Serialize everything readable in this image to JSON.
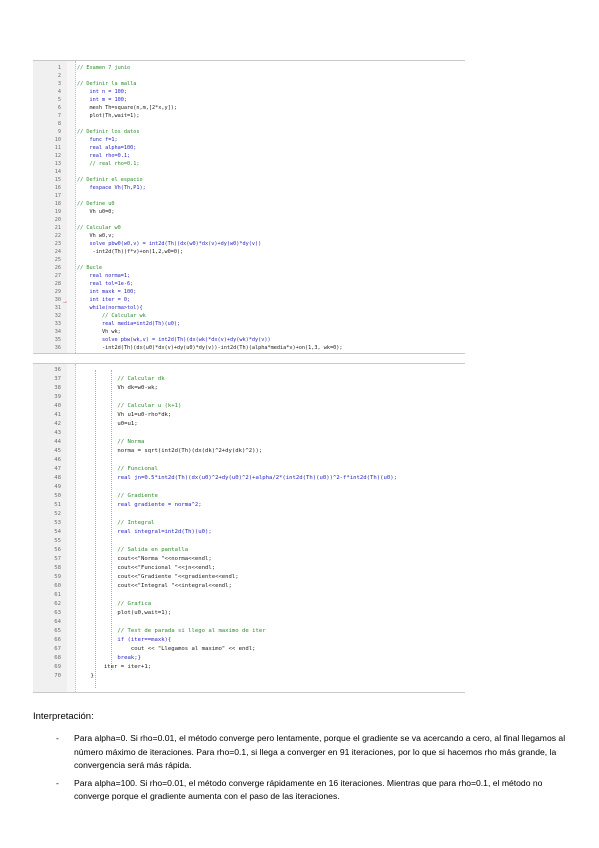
{
  "editor_top": {
    "lines": [
      {
        "n": "1",
        "text": "// Examen 7 junio",
        "kind": "comment"
      },
      {
        "n": "2",
        "text": "",
        "kind": "plain"
      },
      {
        "n": "3",
        "text": "// Definir la malla",
        "kind": "comment"
      },
      {
        "n": "4",
        "text": "    int n = 100;",
        "kind": "keyword"
      },
      {
        "n": "5",
        "text": "    int m = 100;",
        "kind": "keyword"
      },
      {
        "n": "6",
        "text": "    mesh Th=square(n,m,[2*x,y]);",
        "kind": "plain"
      },
      {
        "n": "7",
        "text": "    plot(Th,wait=1);",
        "kind": "plain"
      },
      {
        "n": "8",
        "text": "",
        "kind": "plain"
      },
      {
        "n": "9",
        "text": "// Definir los datos",
        "kind": "comment"
      },
      {
        "n": "10",
        "text": "    func f=1;",
        "kind": "keyword"
      },
      {
        "n": "11",
        "text": "    real alpha=100;",
        "kind": "keyword"
      },
      {
        "n": "12",
        "text": "    real rho=0.1;",
        "kind": "keyword"
      },
      {
        "n": "13",
        "text": "    // real rho=0.1;",
        "kind": "comment"
      },
      {
        "n": "14",
        "text": "",
        "kind": "plain"
      },
      {
        "n": "15",
        "text": "// Definir el espacio",
        "kind": "comment"
      },
      {
        "n": "16",
        "text": "    fespace Vh(Th,P1);",
        "kind": "keyword"
      },
      {
        "n": "17",
        "text": "",
        "kind": "plain"
      },
      {
        "n": "18",
        "text": "// Define u0",
        "kind": "comment"
      },
      {
        "n": "19",
        "text": "    Vh u0=0;",
        "kind": "plain"
      },
      {
        "n": "20",
        "text": "",
        "kind": "plain"
      },
      {
        "n": "21",
        "text": "// Calcular w0",
        "kind": "comment"
      },
      {
        "n": "22",
        "text": "    Vh w0,v;",
        "kind": "plain"
      },
      {
        "n": "23",
        "text": "    solve pbw0(w0,v) = int2d(Th)(dx(w0)*dx(v)+dy(w0)*dy(v))",
        "kind": "keyword"
      },
      {
        "n": "24",
        "text": "     -int2d(Th)(f*v)+on(1,2,w0=0);",
        "kind": "plain"
      },
      {
        "n": "25",
        "text": "",
        "kind": "plain"
      },
      {
        "n": "26",
        "text": "// Bucle",
        "kind": "comment"
      },
      {
        "n": "27",
        "text": "    real norma=1;",
        "kind": "keyword"
      },
      {
        "n": "28",
        "text": "    real tol=1e-6;",
        "kind": "keyword"
      },
      {
        "n": "29",
        "text": "    int maxk = 100;",
        "kind": "keyword"
      },
      {
        "n": "30",
        "text": "    int iter = 0;",
        "kind": "keyword"
      },
      {
        "n": "31",
        "text": "    while(norma>tol){",
        "kind": "keyword"
      },
      {
        "n": "32",
        "text": "        // Calcular wk",
        "kind": "comment"
      },
      {
        "n": "33",
        "text": "        real media=int2d(Th)(u0);",
        "kind": "keyword"
      },
      {
        "n": "34",
        "text": "        Vh wk;",
        "kind": "plain"
      },
      {
        "n": "35",
        "text": "        solve pbw(wk,v) = int2d(Th)(dx(wk)*dx(v)+dy(wk)*dy(v))",
        "kind": "keyword"
      },
      {
        "n": "36",
        "text": "        -int2d(Th)(dx(u0)*dx(v)+dy(u0)*dy(v))-int2d(Th)(alpha*media*v)+on(1,3, wk=0);",
        "kind": "plain"
      }
    ]
  },
  "editor_bottom": {
    "lines": [
      {
        "n": "36",
        "text": "",
        "kind": "plain"
      },
      {
        "n": "37",
        "text": "            // Calcular dk",
        "kind": "comment"
      },
      {
        "n": "38",
        "text": "            Vh dk=w0-wk;",
        "kind": "plain"
      },
      {
        "n": "39",
        "text": "",
        "kind": "plain"
      },
      {
        "n": "40",
        "text": "            // Calcular u (k+1)",
        "kind": "comment"
      },
      {
        "n": "41",
        "text": "            Vh u1=u0-rho*dk;",
        "kind": "plain"
      },
      {
        "n": "42",
        "text": "            u0=u1;",
        "kind": "plain"
      },
      {
        "n": "43",
        "text": "",
        "kind": "plain"
      },
      {
        "n": "44",
        "text": "            // Norma",
        "kind": "comment"
      },
      {
        "n": "45",
        "text": "            norma = sqrt(int2d(Th)(dx(dk)^2+dy(dk)^2));",
        "kind": "plain"
      },
      {
        "n": "46",
        "text": "",
        "kind": "plain"
      },
      {
        "n": "47",
        "text": "            // Funcional",
        "kind": "comment"
      },
      {
        "n": "48",
        "text": "            real jn=0.5*int2d(Th)(dx(u0)^2+dy(u0)^2)+alpha/2*(int2d(Th)(u0))^2-f*int2d(Th)(u0);",
        "kind": "keyword"
      },
      {
        "n": "49",
        "text": "",
        "kind": "plain"
      },
      {
        "n": "50",
        "text": "            // Gradiente",
        "kind": "comment"
      },
      {
        "n": "51",
        "text": "            real gradiente = norma^2;",
        "kind": "keyword"
      },
      {
        "n": "52",
        "text": "",
        "kind": "plain"
      },
      {
        "n": "53",
        "text": "            // Integral",
        "kind": "comment"
      },
      {
        "n": "54",
        "text": "            real integral=int2d(Th)(u0);",
        "kind": "keyword"
      },
      {
        "n": "55",
        "text": "",
        "kind": "plain"
      },
      {
        "n": "56",
        "text": "            // Salida en pantalla",
        "kind": "comment"
      },
      {
        "n": "57",
        "text": "            cout<<\"Norma \"<<norma<<endl;",
        "kind": "plain"
      },
      {
        "n": "58",
        "text": "            cout<<\"Funcional \"<<jn<<endl;",
        "kind": "plain"
      },
      {
        "n": "59",
        "text": "            cout<<\"Gradiente \"<<gradiente<<endl;",
        "kind": "plain"
      },
      {
        "n": "60",
        "text": "            cout<<\"Integral \"<<integral<<endl;",
        "kind": "plain"
      },
      {
        "n": "61",
        "text": "",
        "kind": "plain"
      },
      {
        "n": "62",
        "text": "            // Grafica",
        "kind": "comment"
      },
      {
        "n": "63",
        "text": "            plot(u0,wait=1);",
        "kind": "plain"
      },
      {
        "n": "64",
        "text": "",
        "kind": "plain"
      },
      {
        "n": "65",
        "text": "            // Test de parada si llego al maximo de iter",
        "kind": "comment"
      },
      {
        "n": "66",
        "text": "            if (iter==maxk){",
        "kind": "keyword"
      },
      {
        "n": "67",
        "text": "                cout << \"Llegamos al maximo\" << endl;",
        "kind": "plain"
      },
      {
        "n": "68",
        "text": "            break;}",
        "kind": "keyword"
      },
      {
        "n": "69",
        "text": "        iter = iter+1;",
        "kind": "plain"
      },
      {
        "n": "70",
        "text": "    }",
        "kind": "plain"
      }
    ]
  },
  "interpretation": {
    "title": "Interpretación:",
    "bullets": [
      "Para alpha=0. Si rho=0.01, el método converge pero lentamente, porque el gradiente se va acercando a cero, al final llegamos al número máximo de iteraciones. Para rho=0.1, si llega a converger en 91 iteraciones, por lo que si hacemos rho más grande, la convergencia será más rápida.",
      "Para alpha=100. Si rho=0.01, el método converge rápidamente en 16 iteraciones. Mientras que para rho=0.1, el método no converge porque el gradiente aumenta con el paso de las iteraciones."
    ],
    "bullet_marker": "-"
  },
  "colors": {
    "comment": "#2e8b2e",
    "keyword": "#1f1fbf",
    "gutter": "#f0f0f0",
    "breakpoint": "#cc0000"
  }
}
